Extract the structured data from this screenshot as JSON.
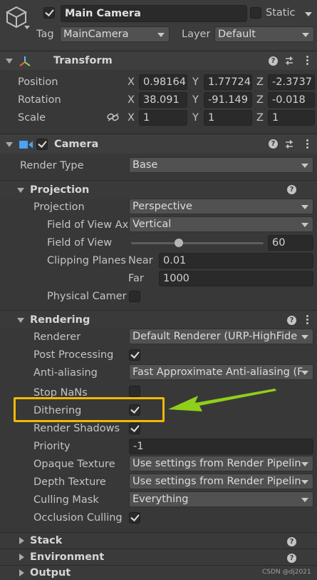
{
  "object": {
    "active": true,
    "name": "Main Camera",
    "static_label": "Static",
    "static_checked": false,
    "tag_label": "Tag",
    "tag_value": "MainCamera",
    "layer_label": "Layer",
    "layer_value": "Default"
  },
  "transform": {
    "title": "Transform",
    "position_label": "Position",
    "rotation_label": "Rotation",
    "scale_label": "Scale",
    "axis_x": "X",
    "axis_y": "Y",
    "axis_z": "Z",
    "position": {
      "x": "0.98164",
      "y": "1.77724",
      "z": "-2.3737"
    },
    "rotation": {
      "x": "38.091",
      "y": "-91.149",
      "z": "-0.018"
    },
    "scale": {
      "x": "1",
      "y": "1",
      "z": "1"
    }
  },
  "camera": {
    "title": "Camera",
    "enabled": true,
    "render_type_label": "Render Type",
    "render_type_value": "Base",
    "projection_section": "Projection",
    "projection_label": "Projection",
    "projection_value": "Perspective",
    "fov_axis_label": "Field of View Ax",
    "fov_axis_value": "Vertical",
    "fov_label": "Field of View",
    "fov_value": "60",
    "fov_slider_fraction": 0.36,
    "clipping_label": "Clipping Planes",
    "near_label": "Near",
    "near_value": "0.01",
    "far_label": "Far",
    "far_value": "1000",
    "physical_label": "Physical Camer",
    "physical_checked": false,
    "rendering_section": "Rendering",
    "renderer_label": "Renderer",
    "renderer_value": "Default Renderer (URP-HighFide",
    "post_label": "Post Processing",
    "post_checked": true,
    "aa_label": "Anti-aliasing",
    "aa_value": "Fast Approximate Anti-aliasing (F",
    "stopnans_label": "Stop NaNs",
    "stopnans_checked": false,
    "dithering_label": "Dithering",
    "dithering_checked": true,
    "shadows_label": "Render Shadows",
    "shadows_checked": true,
    "priority_label": "Priority",
    "priority_value": "-1",
    "opaque_label": "Opaque Texture",
    "opaque_value": "Use settings from Render Pipelin",
    "depth_label": "Depth Texture",
    "depth_value": "Use settings from Render Pipelin",
    "culling_label": "Culling Mask",
    "culling_value": "Everything",
    "occlusion_label": "Occlusion Culling",
    "occlusion_checked": true,
    "stack_section": "Stack",
    "environment_section": "Environment",
    "output_section": "Output"
  },
  "annotation": {
    "highlight_color": "#f2b807",
    "arrow_color": "#8fcf1a",
    "watermark": "CSDN @dj2021"
  }
}
